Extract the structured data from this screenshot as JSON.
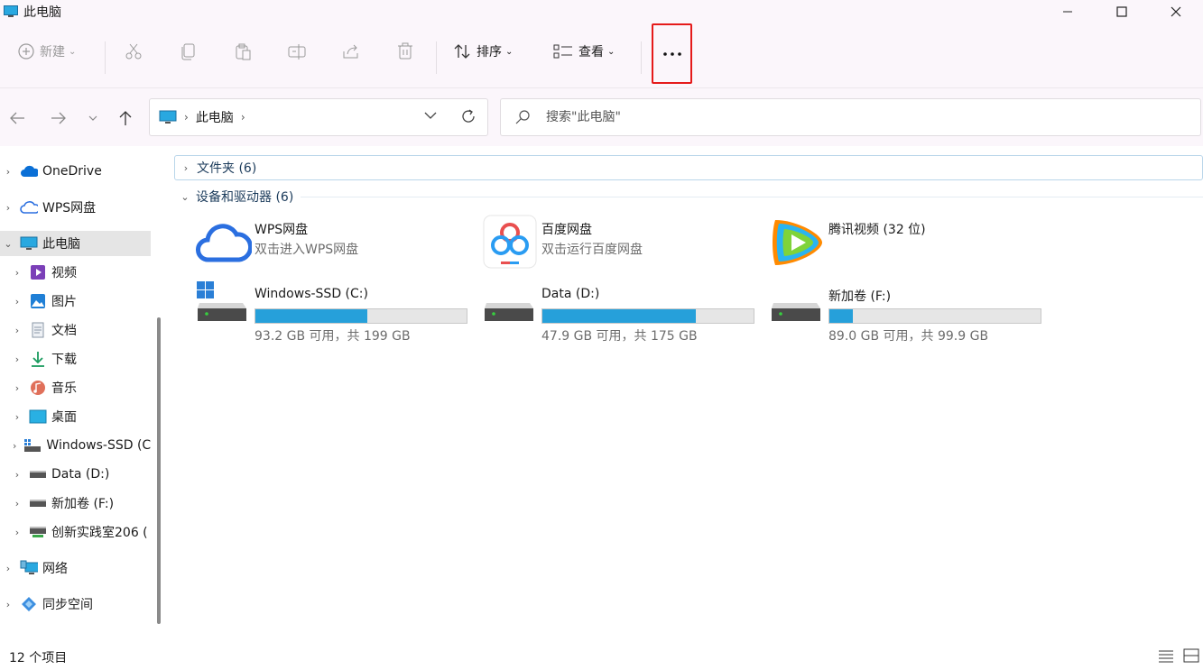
{
  "window": {
    "title": "此电脑"
  },
  "toolbar": {
    "new_label": "新建",
    "sort_label": "排序",
    "view_label": "查看"
  },
  "address": {
    "crumb": "此电脑"
  },
  "search": {
    "placeholder": "搜索\"此电脑\""
  },
  "sidebar": {
    "items": [
      {
        "label": "OneDrive"
      },
      {
        "label": "WPS网盘"
      },
      {
        "label": "此电脑"
      },
      {
        "label": "视频"
      },
      {
        "label": "图片"
      },
      {
        "label": "文档"
      },
      {
        "label": "下载"
      },
      {
        "label": "音乐"
      },
      {
        "label": "桌面"
      },
      {
        "label": "Windows-SSD (C:)"
      },
      {
        "label": "Data (D:)"
      },
      {
        "label": "新加卷 (F:)"
      },
      {
        "label": "创新实践室206 ("
      },
      {
        "label": "网络"
      },
      {
        "label": "同步空间"
      }
    ]
  },
  "content": {
    "folders_group": "文件夹 (6)",
    "devices_group": "设备和驱动器 (6)",
    "apps": [
      {
        "name": "WPS网盘",
        "sub": "双击进入WPS网盘"
      },
      {
        "name": "百度网盘",
        "sub": "双击运行百度网盘"
      },
      {
        "name": "腾讯视频 (32 位)"
      }
    ],
    "drives": [
      {
        "name": "Windows-SSD (C:)",
        "free": "93.2 GB 可用，共 199 GB",
        "used_fraction": 0.532
      },
      {
        "name": "Data (D:)",
        "free": "47.9 GB 可用，共 175 GB",
        "used_fraction": 0.726
      },
      {
        "name": "新加卷 (F:)",
        "free": "89.0 GB 可用，共 99.9 GB",
        "used_fraction": 0.109
      }
    ]
  },
  "status": {
    "count": "12 个项目"
  },
  "colors": {
    "accent": "#26a0da",
    "highlight": "#e51a1a"
  }
}
